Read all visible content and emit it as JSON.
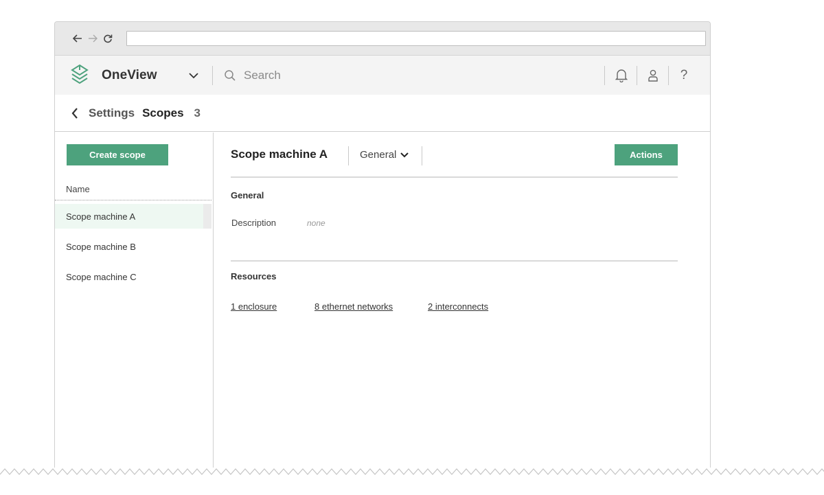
{
  "browser": {
    "back_icon": "arrow-left-icon",
    "forward_icon": "arrow-right-icon",
    "reload_icon": "reload-icon",
    "url": ""
  },
  "app": {
    "brand": "OneView",
    "logo_icon": "stacked-layers-logo",
    "search_placeholder": "Search",
    "icons": [
      "bell-icon",
      "user-icon",
      "help-icon"
    ],
    "help_glyph": "?",
    "accent_color": "#4da27d"
  },
  "breadcrumb": {
    "parent": "Settings",
    "current": "Scopes",
    "count": "3"
  },
  "sidebar": {
    "create_label": "Create scope",
    "column_header": "Name",
    "items": [
      {
        "label": "Scope machine A",
        "selected": true
      },
      {
        "label": "Scope machine B",
        "selected": false
      },
      {
        "label": "Scope machine C",
        "selected": false
      }
    ]
  },
  "main": {
    "title": "Scope machine A",
    "view_selector": "General",
    "actions_label": "Actions",
    "general": {
      "heading": "General",
      "description_label": "Description",
      "description_value": "none"
    },
    "resources": {
      "heading": "Resources",
      "links": [
        "1 enclosure",
        "8 ethernet networks",
        "2 interconnects"
      ]
    }
  }
}
